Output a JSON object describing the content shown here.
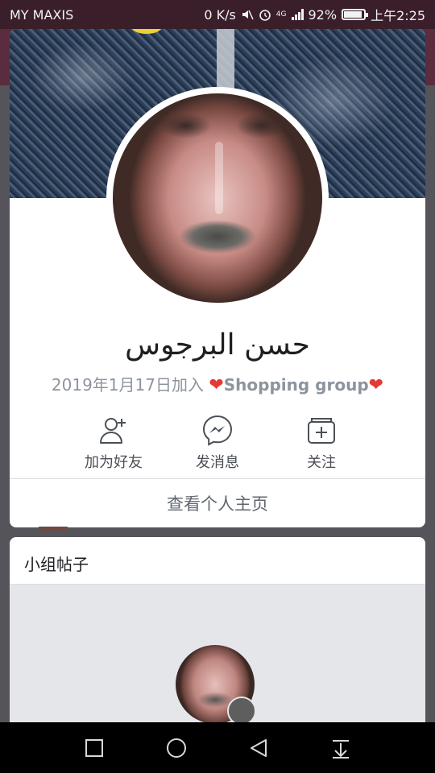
{
  "status_bar": {
    "carrier": "MY MAXIS",
    "speed": "0 K/s",
    "network": "4G",
    "battery": "92%",
    "battery_level": 0.92,
    "time": "上午2:25",
    "icons": [
      "mute-icon",
      "alarm-icon",
      "signal-icon",
      "battery-icon"
    ]
  },
  "profile": {
    "name": "حسن البرجوس",
    "joined": "2019年1月17日加入",
    "group": "Shopping group",
    "heart": "❤",
    "actions": [
      {
        "label": "加为好友",
        "icon": "add-friend-icon"
      },
      {
        "label": "发消息",
        "icon": "messenger-icon"
      },
      {
        "label": "关注",
        "icon": "follow-icon"
      }
    ],
    "view_profile": "查看个人主页"
  },
  "posts": {
    "title": "小组帖子"
  },
  "nav": {
    "icons": [
      "recents-square-icon",
      "home-circle-icon",
      "back-triangle-icon",
      "notification-pull-icon"
    ]
  },
  "colors": {
    "background": "#55545a",
    "status_bar": "#3a1f2b",
    "card": "#ffffff",
    "muted_text": "#8d949e",
    "heart": "#e53935"
  }
}
